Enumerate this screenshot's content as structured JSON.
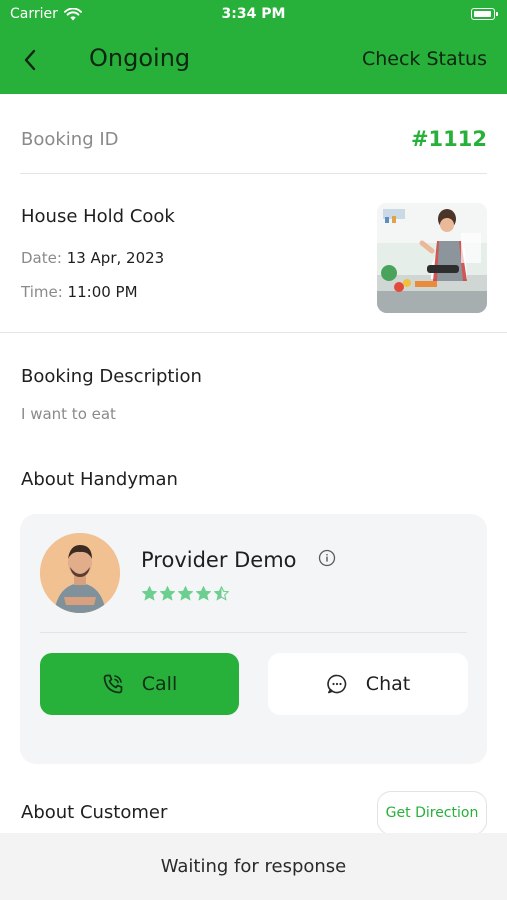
{
  "status_bar": {
    "carrier": "Carrier",
    "time": "3:34 PM"
  },
  "header": {
    "title": "Ongoing",
    "action": "Check Status"
  },
  "booking": {
    "id_label": "Booking ID",
    "id_value": "#1112",
    "service_name": "House Hold Cook",
    "date_label": "Date:",
    "date_value": "13 Apr, 2023",
    "time_label": "Time:",
    "time_value": "11:00 PM"
  },
  "description": {
    "title": "Booking Description",
    "text": "I want to eat"
  },
  "handyman": {
    "section_title": "About Handyman",
    "name": "Provider Demo",
    "rating": 4.5,
    "call_label": "Call",
    "chat_label": "Chat"
  },
  "customer": {
    "section_title": "About Customer",
    "direction_label": "Get Direction"
  },
  "footer": {
    "status": "Waiting for response"
  },
  "colors": {
    "primary": "#27b03a",
    "star": "#6ccf8f",
    "card_bg": "#f4f5f7"
  }
}
